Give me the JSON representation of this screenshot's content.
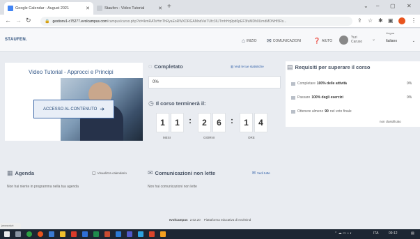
{
  "browser": {
    "tabs": [
      {
        "label": "Google Calendar - August 2021",
        "active": true
      },
      {
        "label": "Staufen - Video Tutorial",
        "active": false
      }
    ],
    "new_tab_icon": "plus-icon",
    "url_host": "gestionv1-c75277.evolcampus.com",
    "url_path": "/campus/curso.php?id=lkmRATsHmThRyaEoRWXDRGAMndVeiTUfc3IUTmhHq9pd0pEF3fuMDh0UmdMDNHl5Rs..."
  },
  "app": {
    "logo": "STAUFEN.",
    "nav": [
      {
        "label": "INIZIO",
        "icon": "home-icon"
      },
      {
        "label": "COMUNICAZIONI",
        "icon": "envelope-icon"
      },
      {
        "label": "AIUTO",
        "icon": "help-icon"
      }
    ],
    "user_first": "Yuri",
    "user_last": "Caruso",
    "language_label": "Lingua",
    "language_value": "Italiano"
  },
  "video": {
    "title": "Video Tutorial - Approcci e Principi",
    "access_label": "ACCESSO AL CONTENUTO"
  },
  "progress": {
    "heading": "Completato",
    "stats_link": "Vedi le tue statistiche",
    "percent": "0%",
    "ends_heading": "Il corso terminerà il:",
    "countdown": {
      "days": [
        "1",
        "1"
      ],
      "hours": [
        "2",
        "6"
      ],
      "minutes": [
        "1",
        "4"
      ]
    },
    "labels": {
      "days": "MESI",
      "hours": "GIORNI",
      "minutes": "ORE"
    }
  },
  "requirements": {
    "heading": "Requisiti per superare il corso",
    "items": [
      {
        "pre": "Completare",
        "bold": "100% delle attività",
        "post": "",
        "pct": "0%"
      },
      {
        "pre": "Passare",
        "bold": "100% degli esercizi",
        "post": "",
        "pct": "0%"
      },
      {
        "pre": "Ottenere almeno",
        "bold": "90",
        "post": "nel voto finale",
        "pct": ""
      }
    ],
    "status": "non classificato"
  },
  "agenda": {
    "heading": "Agenda",
    "link": "Visualizza calendario",
    "empty": "Non hai niente in programma nella tua agenda"
  },
  "messages": {
    "heading": "Comunicazioni non lette",
    "link": "Vedi tutte",
    "empty": "Non hai comunicazioni non lette"
  },
  "footer": {
    "brand": "evolCampus",
    "version": "2.02.20",
    "text": "Piattaforma educativa di evolmind"
  },
  "status_bar": "javascript:",
  "taskbar": {
    "tray_lang": "ITA",
    "clock": "09:12"
  },
  "colors": {
    "accent": "#2f5fa8",
    "header_bg": "#f7f8fa",
    "page_bg": "#e9ecf1",
    "taskbar": "#1d2633"
  }
}
